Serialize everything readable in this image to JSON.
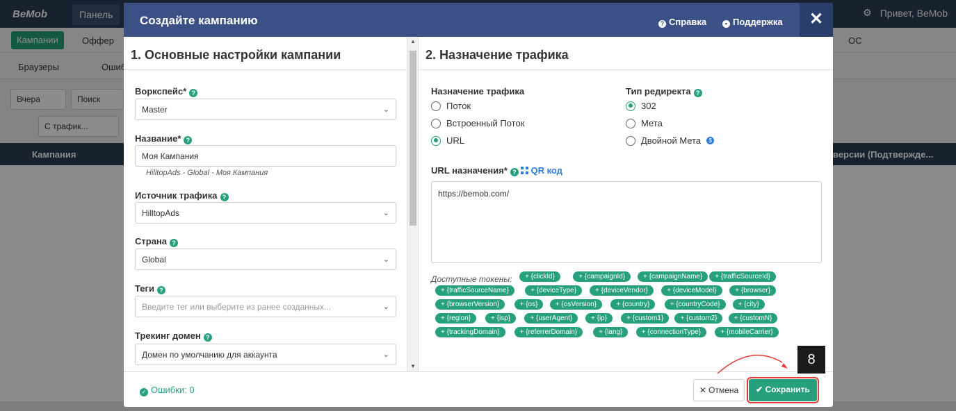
{
  "background": {
    "logo": "BeMob",
    "panel_tab": "Панель",
    "top_right_greeting": "Привет, BeMob",
    "nav_campaigns": "Кампании",
    "nav_offers": "Оффер",
    "nav_os": "ОС",
    "nav_browsers": "Браузеры",
    "nav_errors": "Ошиб",
    "filter_date": "Вчера",
    "filter_search": "Поиск",
    "filter_traffic": "С трафик...",
    "table_col_campaign": "Кампания",
    "table_col_conversions": "версии (Подтвержде..."
  },
  "modal": {
    "title": "Создайте кампанию",
    "help_link": "Справка",
    "support_link": "Поддержка",
    "close": "✕"
  },
  "left": {
    "section_title": "1. Основные настройки кампании",
    "workspace_label": "Воркспейс*",
    "workspace_value": "Master",
    "name_label": "Название*",
    "name_value": "Моя Кампания",
    "name_hint": "HilltopAds - Global - Моя Кампания",
    "source_label": "Источник трафика",
    "source_value": "HilltopAds",
    "country_label": "Страна",
    "country_value": "Global",
    "tags_label": "Теги",
    "tags_placeholder": "Введите тег или выберите из ранее созданных...",
    "domain_label": "Трекинг домен",
    "domain_value": "Домен по умолчанию для аккаунта"
  },
  "right": {
    "section_title": "2. Назначение трафика",
    "dest_label": "Назначение трафика",
    "dest_options": [
      "Поток",
      "Встроенный Поток",
      "URL"
    ],
    "dest_selected": 2,
    "redirect_label": "Тип редиректа",
    "redirect_options": [
      "302",
      "Мета",
      "Двойной Мета"
    ],
    "redirect_selected": 0,
    "url_label": "URL назначения*",
    "qr_link": "QR код",
    "url_value": "https://bemob.com/",
    "tokens_label": "Доступные токены:",
    "tokens": [
      "+ {clickId}",
      "+ {campaignId}",
      "+ {campaignName}",
      "+ {trafficSourceId}",
      "+ {trafficSourceName}",
      "+ {deviceType}",
      "+ {deviceVendor}",
      "+ {deviceModel}",
      "+ {browser}",
      "+ {browserVersion}",
      "+ {os}",
      "+ {osVersion}",
      "+ {country}",
      "+ {countryCode}",
      "+ {city}",
      "+ {region}",
      "+ {isp}",
      "+ {userAgent}",
      "+ {ip}",
      "+ {custom1}",
      "+ {custom2}",
      "+ {customN}",
      "+ {trackingDomain}",
      "+ {referrerDomain}",
      "+ {lang}",
      "+ {connectionType}",
      "+ {mobileCarrier}"
    ]
  },
  "footer": {
    "errors": "Ошибки: 0",
    "cancel": "Отмена",
    "save": "Сохранить"
  },
  "annotation": {
    "step": "8"
  },
  "colors": {
    "accent_green": "#26a07d",
    "header_blue": "#3b5185",
    "highlight_red": "#e53935"
  }
}
